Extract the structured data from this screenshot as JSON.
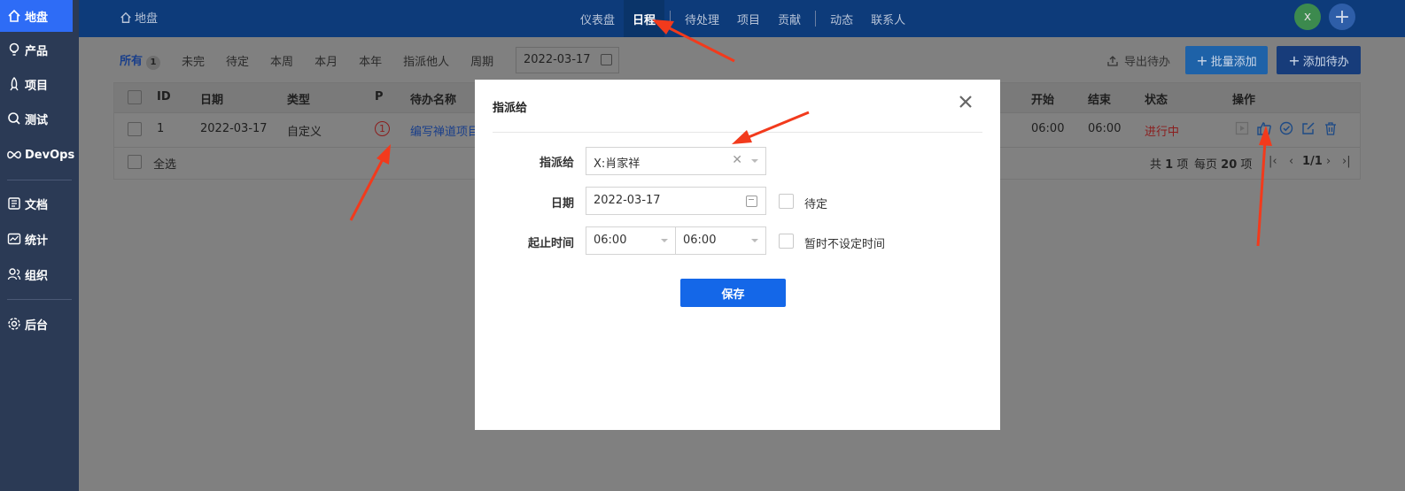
{
  "sidebar": {
    "items": [
      {
        "label": "地盘",
        "icon": "home-icon"
      },
      {
        "label": "产品",
        "icon": "lightbulb-icon"
      },
      {
        "label": "项目",
        "icon": "rocket-icon"
      },
      {
        "label": "测试",
        "icon": "search-test-icon"
      },
      {
        "label": "DevOps",
        "icon": "infinity-icon"
      },
      {
        "label": "文档",
        "icon": "document-icon"
      },
      {
        "label": "统计",
        "icon": "chart-icon"
      },
      {
        "label": "组织",
        "icon": "people-icon"
      },
      {
        "label": "后台",
        "icon": "gear-icon"
      }
    ]
  },
  "topbar": {
    "crumb": "地盘",
    "nav": [
      "仪表盘",
      "日程",
      "待处理",
      "项目",
      "贡献",
      "动态",
      "联系人"
    ],
    "active_nav": "日程",
    "avatar": "x",
    "plus": "+"
  },
  "filters": {
    "tabs": [
      "所有",
      "未完",
      "待定",
      "本周",
      "本月",
      "本年",
      "指派他人",
      "周期"
    ],
    "all_count": "1",
    "date": "2022-03-17",
    "export": "导出待办",
    "batch_add": "批量添加",
    "add": "添加待办"
  },
  "table": {
    "headers": [
      "ID",
      "日期",
      "类型",
      "P",
      "待办名称",
      "开始",
      "结束",
      "状态",
      "操作"
    ],
    "rows": [
      {
        "id": "1",
        "date": "2022-03-17",
        "type": "自定义",
        "priority": "1",
        "name": "编写禅道项目",
        "start": "06:00",
        "end": "06:00",
        "status": "进行中"
      }
    ],
    "select_all": "全选",
    "pager": {
      "total_prefix": "共",
      "total": "1",
      "total_suffix": "项",
      "per_page_prefix": "每页",
      "per_page": "20",
      "per_page_suffix": "项",
      "page": "1/1"
    }
  },
  "modal": {
    "title": "指派给",
    "assign_label": "指派给",
    "assign_value": "X:肖家祥",
    "date_label": "日期",
    "date_value": "2022-03-17",
    "pending_label": "待定",
    "time_label": "起止时间",
    "start_time": "06:00",
    "end_time": "06:00",
    "no_time_label": "暂时不设定时间",
    "save": "保存"
  },
  "colors": {
    "sidebar_bg": "#2b3a55",
    "accent": "#1467e8",
    "annotation": "#f23a1c"
  }
}
